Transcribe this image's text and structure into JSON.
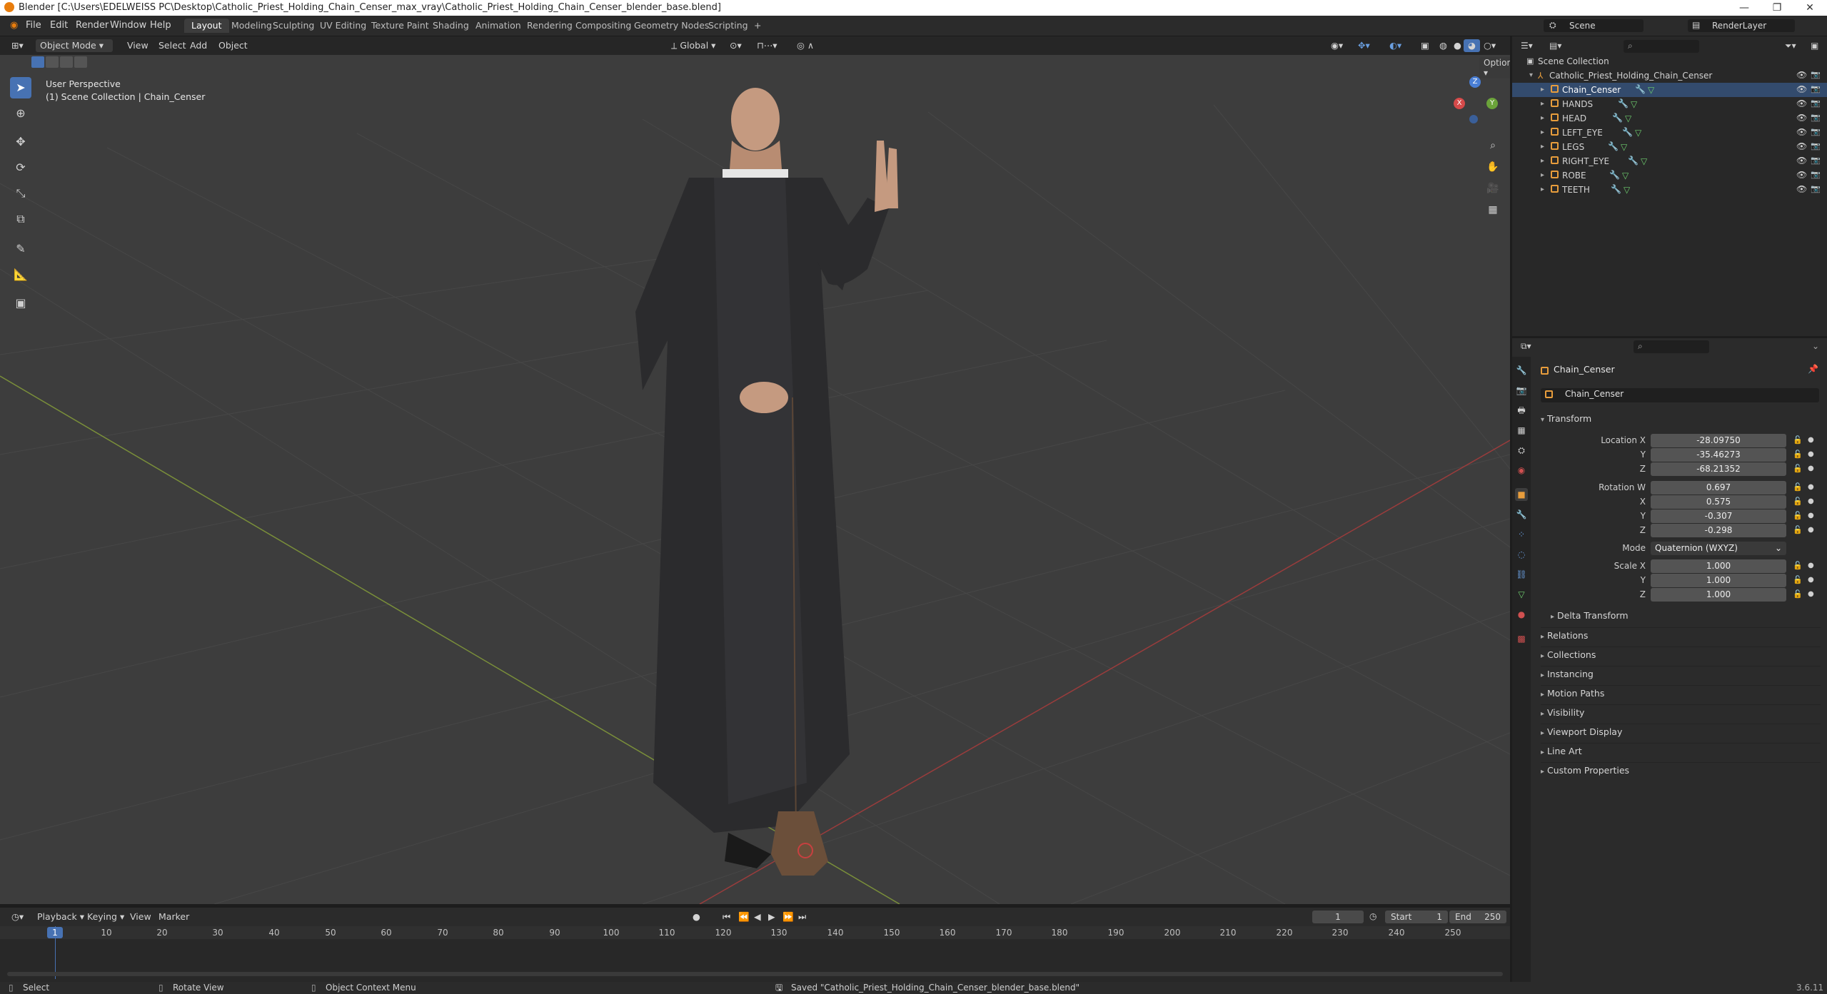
{
  "window": {
    "title": "Blender [C:\\Users\\EDELWEISS PC\\Desktop\\Catholic_Priest_Holding_Chain_Censer_max_vray\\Catholic_Priest_Holding_Chain_Censer_blender_base.blend]",
    "minimize": "—",
    "maximize": "❐",
    "close": "✕"
  },
  "menubar": {
    "items": [
      "File",
      "Edit",
      "Render",
      "Window",
      "Help"
    ],
    "workspaces": [
      "Layout",
      "Modeling",
      "Sculpting",
      "UV Editing",
      "Texture Paint",
      "Shading",
      "Animation",
      "Rendering",
      "Compositing",
      "Geometry Nodes",
      "Scripting"
    ],
    "add_workspace": "+",
    "scene_label": "Scene",
    "render_layer_label": "RenderLayer"
  },
  "viewport_header": {
    "mode": "Object Mode",
    "menus": [
      "View",
      "Select",
      "Add",
      "Object"
    ],
    "orientation": "Global",
    "options": "Options"
  },
  "viewport": {
    "perspective": "User Perspective",
    "collection_info": "(1) Scene Collection | Chain_Censer",
    "gizmo_x": "X",
    "gizmo_y": "Y",
    "gizmo_z": "Z"
  },
  "outliner": {
    "root": "Scene Collection",
    "collection": "Catholic_Priest_Holding_Chain_Censer",
    "objects": [
      "Chain_Censer",
      "HANDS",
      "HEAD",
      "LEFT_EYE",
      "LEGS",
      "RIGHT_EYE",
      "ROBE",
      "TEETH"
    ]
  },
  "properties": {
    "object_name": "Chain_Censer",
    "data_name": "Chain_Censer",
    "transform_header": "Transform",
    "location_label": "Location X",
    "location": [
      "-28.09750",
      "-35.46273",
      "-68.21352"
    ],
    "rotation_label": "Rotation W",
    "rotation": [
      "0.697",
      "0.575",
      "-0.307",
      "-0.298"
    ],
    "mode_label": "Mode",
    "mode_value": "Quaternion (WXYZ)",
    "scale_label": "Scale X",
    "scale": [
      "1.000",
      "1.000",
      "1.000"
    ],
    "axis_y": "Y",
    "axis_z": "Z",
    "axis_x": "X",
    "delta_transform": "Delta Transform",
    "panels": [
      "Relations",
      "Collections",
      "Instancing",
      "Motion Paths",
      "Visibility",
      "Viewport Display",
      "Line Art",
      "Custom Properties"
    ]
  },
  "timeline": {
    "menus": [
      "Playback",
      "Keying",
      "View",
      "Marker"
    ],
    "current_frame": "1",
    "start_label": "Start",
    "start_value": "1",
    "end_label": "End",
    "end_value": "250",
    "ticks": [
      "1",
      "10",
      "20",
      "30",
      "40",
      "50",
      "60",
      "70",
      "80",
      "90",
      "100",
      "110",
      "120",
      "130",
      "140",
      "150",
      "160",
      "170",
      "180",
      "190",
      "200",
      "210",
      "220",
      "230",
      "240",
      "250"
    ]
  },
  "statusbar": {
    "select": "Select",
    "rotate": "Rotate View",
    "context": "Object Context Menu",
    "saved": "Saved \"Catholic_Priest_Holding_Chain_Censer_blender_base.blend\"",
    "version": "3.6.11"
  },
  "colors": {
    "accent": "#4772b3",
    "object_orange": "#e89d3c",
    "mesh_green": "#6fcf6f"
  }
}
